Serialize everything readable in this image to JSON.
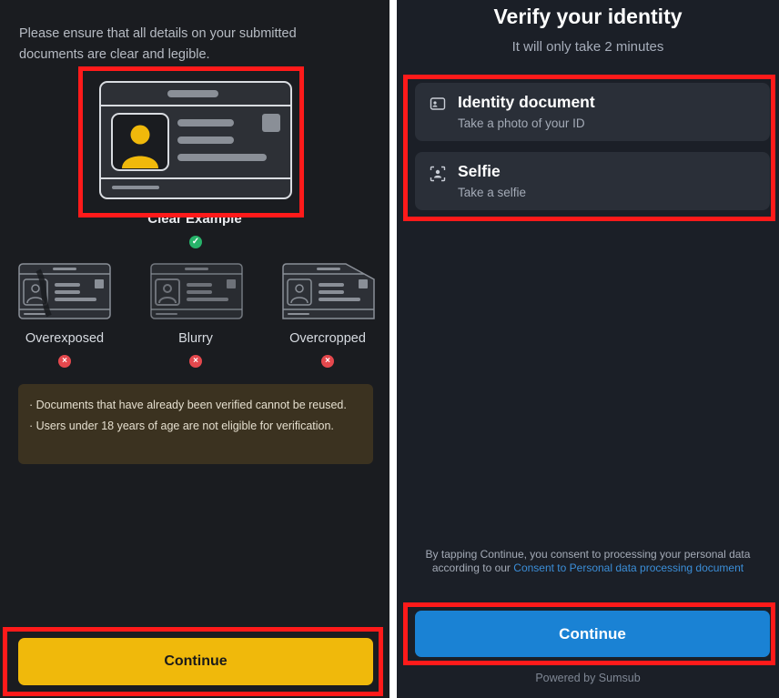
{
  "left": {
    "intro": "Please ensure that all details on your submitted documents are clear and legible.",
    "clear_example": "Clear Example",
    "examples": [
      {
        "label": "Overexposed"
      },
      {
        "label": "Blurry"
      },
      {
        "label": "Overcropped"
      }
    ],
    "notes": [
      "· Documents that have already been verified cannot be reused.",
      "· Users under 18 years of age are not eligible for verification."
    ],
    "continue_label": "Continue",
    "accent": "#f0b90b",
    "ok_icon": "check-circle-icon",
    "bad_icon": "x-circle-icon"
  },
  "right": {
    "title": "Verify your identity",
    "subtitle": "It will only take 2 minutes",
    "options": [
      {
        "title": "Identity document",
        "subtitle": "Take a photo of your ID",
        "icon": "id-card-icon"
      },
      {
        "title": "Selfie",
        "subtitle": "Take a selfie",
        "icon": "face-scan-icon"
      }
    ],
    "consent_prefix": "By tapping Continue, you consent to processing your personal data according to our",
    "consent_link": "Consent to Personal data processing document",
    "continue_label": "Continue",
    "powered_by": "Powered by Sumsub",
    "accent": "#1a82d4"
  },
  "highlight_color": "#ff1a1a"
}
